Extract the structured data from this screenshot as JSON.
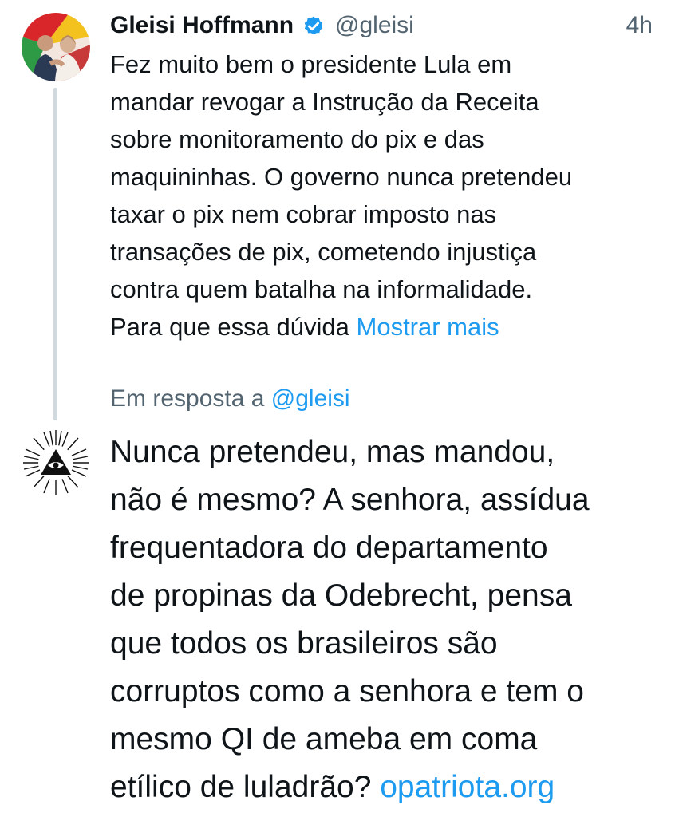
{
  "tweet": {
    "author_name": "Gleisi Hoffmann",
    "handle": "@gleisi",
    "time": "4h",
    "lines": [
      "Fez muito bem o presidente Lula em",
      "mandar revogar a Instrução da Receita",
      "sobre monitoramento do pix e das",
      "maquininhas. O governo nunca pretendeu",
      "taxar o pix nem cobrar imposto nas",
      "transações de pix, cometendo injustiça",
      "contra quem  batalha na informalidade.",
      "Para que essa dúvida "
    ],
    "show_more": "Mostrar mais",
    "avatar_icon": "person-photo-avatar",
    "verified_icon": "verified-badge-icon"
  },
  "reply": {
    "context_prefix": "Em resposta a ",
    "context_handle": "@gleisi",
    "lines": [
      "Nunca pretendeu, mas mandou,",
      "não é mesmo? A senhora, assídua",
      "frequentadora do departamento",
      "de propinas da Odebrecht, pensa",
      "que todos os brasileiros são",
      "corruptos como a senhora e tem o",
      "mesmo QI de ameba em coma",
      "etílico de luladrão? "
    ],
    "link": "opatriota.org",
    "avatar_icon": "all-seeing-eye-avatar"
  },
  "colors": {
    "text": "#0f1419",
    "secondary": "#536471",
    "link": "#1d9bf0",
    "thread_line": "#cfd9de"
  }
}
